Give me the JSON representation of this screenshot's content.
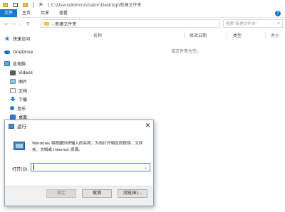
{
  "titlebar": {
    "path": "| C:\\Users\\Administrator\\Desktop\\新建文件夹"
  },
  "ribbon": {
    "tabs": [
      "文件",
      "主页",
      "共享",
      "查看"
    ]
  },
  "address": {
    "back": "←",
    "forward": "→",
    "up": "↑",
    "text": "› 新建文件夹",
    "search_placeholder": "搜索\"新建文件夹\""
  },
  "columns": {
    "name": "名称",
    "modified": "修改日期",
    "type": "类型",
    "size": "大小"
  },
  "empty_message": "该文件夹为空。",
  "nav_items": [
    "快速访问",
    "OneDrive",
    "此电脑",
    "Videos",
    "图片",
    "文档",
    "下载",
    "音乐",
    "桌面"
  ],
  "run": {
    "title": "运行",
    "close": "✕",
    "description": "Windows 将根据你所输入的名称，为你打开相应的程序、文件夹、文档或 Internet 资源。",
    "open_label": "打开(O):",
    "input_value": "",
    "ok": "确定",
    "cancel": "取消",
    "browse": "浏览(B)..."
  }
}
